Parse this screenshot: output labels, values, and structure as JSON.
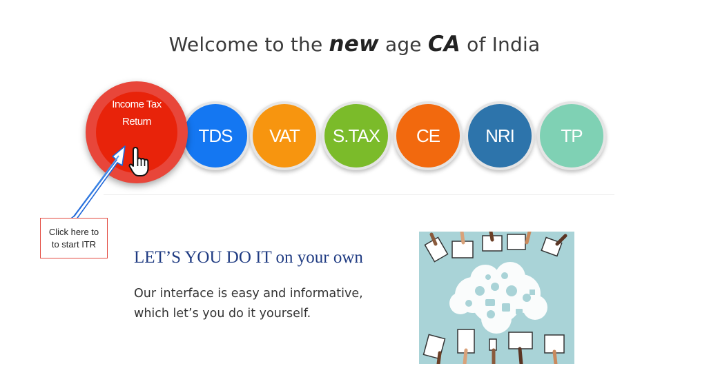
{
  "header": {
    "prefix": "Welcome to the",
    "emphasis_new": "new",
    "middle": "age",
    "emphasis_ca": "CA",
    "suffix": "of India"
  },
  "services": [
    {
      "label_line1": "Income Tax",
      "label_line2": "Return",
      "color": "#e8230a",
      "ring_color": "#e8463a"
    },
    {
      "label": "TDS",
      "color": "#1477f2"
    },
    {
      "label": "VAT",
      "color": "#f7950f"
    },
    {
      "label": "S.TAX",
      "color": "#7bbb2a"
    },
    {
      "label": "CE",
      "color": "#f2690e"
    },
    {
      "label": "NRI",
      "color": "#2d74ab"
    },
    {
      "label": "TP",
      "color": "#7fd1b4"
    }
  ],
  "callout": {
    "line1": "Click here to",
    "line2": "to start ITR",
    "border_color": "#e2463c"
  },
  "cursor_icon": "hand-pointer-icon",
  "section": {
    "tagline": "LET’S YOU DO IT on your own",
    "description_line1": "Our interface is easy and informative,",
    "description_line2": "which let’s you do it yourself."
  },
  "illustration": {
    "icon": "cloud-collaboration-illustration",
    "background": "#a9d3d7"
  }
}
